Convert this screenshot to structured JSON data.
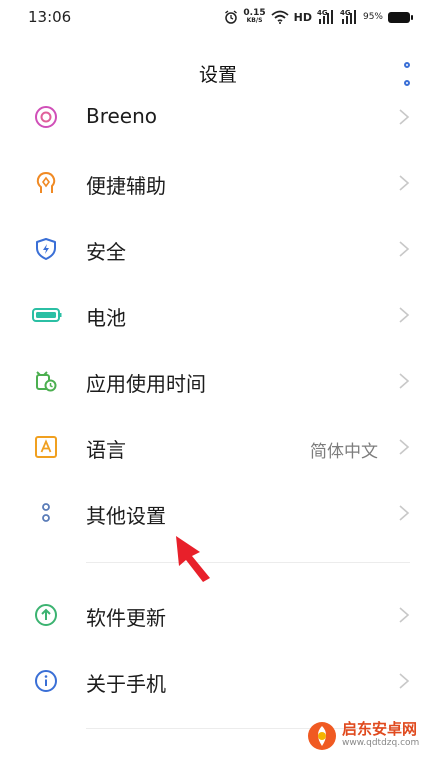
{
  "status_bar": {
    "time": "13:06",
    "speed_value": "0.15",
    "speed_unit": "KB/S",
    "hd": "HD",
    "network_1": "4G",
    "network_2": "4G",
    "battery": "95%"
  },
  "header": {
    "title": "设置",
    "more_icon": "more-vertical-dots-icon"
  },
  "items": [
    {
      "label": "Breeno",
      "icon": "breeno-icon",
      "value": ""
    },
    {
      "label": "便捷辅助",
      "icon": "accessibility-hand-icon",
      "value": ""
    },
    {
      "label": "安全",
      "icon": "shield-icon",
      "value": ""
    },
    {
      "label": "电池",
      "icon": "battery-icon",
      "value": ""
    },
    {
      "label": "应用使用时间",
      "icon": "app-usage-clock-icon",
      "value": ""
    },
    {
      "label": "语言",
      "icon": "language-icon",
      "value": "简体中文"
    },
    {
      "label": "其他设置",
      "icon": "other-settings-icon",
      "value": ""
    },
    {
      "label": "软件更新",
      "icon": "update-icon",
      "value": ""
    },
    {
      "label": "关于手机",
      "icon": "info-icon",
      "value": ""
    }
  ],
  "annotation": {
    "arrow_color": "#e8202a"
  },
  "watermark": {
    "name": "启东安卓网",
    "url": "www.qdtdzq.com"
  },
  "colors": {
    "accent": "#3a6fd6",
    "breeno": "#d04fb8",
    "accessibility": "#f08a24",
    "security": "#3a6fd6",
    "battery": "#2bbfa4",
    "app_usage": "#4caf50",
    "language": "#f0a020",
    "update": "#3cb371",
    "info": "#3a6fd6"
  }
}
